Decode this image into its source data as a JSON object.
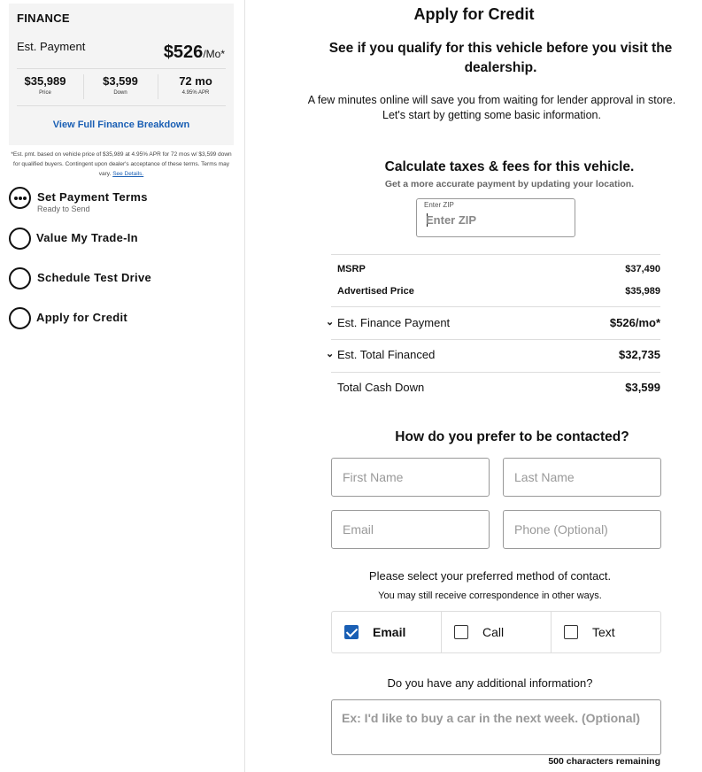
{
  "finance": {
    "title": "FINANCE",
    "est_payment_label": "Est. Payment",
    "est_payment_value": "$526",
    "est_payment_unit": "/Mo*",
    "stats": [
      {
        "value": "$35,989",
        "label": "Price"
      },
      {
        "value": "$3,599",
        "label": "Down"
      },
      {
        "value": "72 mo",
        "label": "4.95% APR"
      }
    ],
    "breakdown_link": "View Full Finance Breakdown",
    "disclaimer": "*Est. pmt. based on vehicle price of $35,989 at 4.95% APR for 72 mos w/ $3,599 down for qualified buyers. Contingent upon dealer's acceptance of these terms. Terms may vary.",
    "disclaimer_link": "See Details."
  },
  "steps": [
    {
      "label": "Set Payment Terms",
      "sub": "Ready to Send",
      "icon": "ellipsis-circle-icon"
    },
    {
      "label": "Value My Trade-In",
      "sub": "",
      "icon": "empty-circle-icon"
    },
    {
      "label": "Schedule Test Drive",
      "sub": "",
      "icon": "empty-circle-icon"
    },
    {
      "label": "Apply for Credit",
      "sub": "",
      "icon": "empty-circle-icon"
    }
  ],
  "main": {
    "title": "Apply for Credit",
    "subtitle": "See if you qualify for this vehicle before you visit the dealership.",
    "intro_line1": "A few minutes online will save you from waiting for lender approval in store.",
    "intro_line2": "Let's start by getting some basic information."
  },
  "taxes": {
    "title": "Calculate taxes & fees for this vehicle.",
    "subtitle": "Get a more accurate payment by updating your location.",
    "zip_label": "Enter ZIP",
    "zip_placeholder": "Enter ZIP",
    "zip_value": ""
  },
  "summary": {
    "msrp_label": "MSRP",
    "msrp_value": "$37,490",
    "advertised_label": "Advertised Price",
    "advertised_value": "$35,989",
    "finance_payment_label": "Est. Finance Payment",
    "finance_payment_value": "$526/mo*",
    "total_financed_label": "Est. Total Financed",
    "total_financed_value": "$32,735",
    "cash_down_label": "Total Cash Down",
    "cash_down_value": "$3,599"
  },
  "contact": {
    "title": "How do you prefer to be contacted?",
    "first_name_placeholder": "First Name",
    "last_name_placeholder": "Last Name",
    "email_placeholder": "Email",
    "phone_placeholder": "Phone (Optional)",
    "pref_title": "Please select your preferred method of contact.",
    "pref_sub": "You may still receive correspondence in other ways.",
    "methods": [
      {
        "label": "Email",
        "checked": true
      },
      {
        "label": "Call",
        "checked": false
      },
      {
        "label": "Text",
        "checked": false
      }
    ],
    "additional_title": "Do you have any additional information?",
    "additional_placeholder": "Ex: I'd like to buy a car in the next week. (Optional)",
    "remaining": "500 characters remaining"
  },
  "colors": {
    "accent": "#1a5fb4",
    "card_bg": "#f4f4f4"
  }
}
